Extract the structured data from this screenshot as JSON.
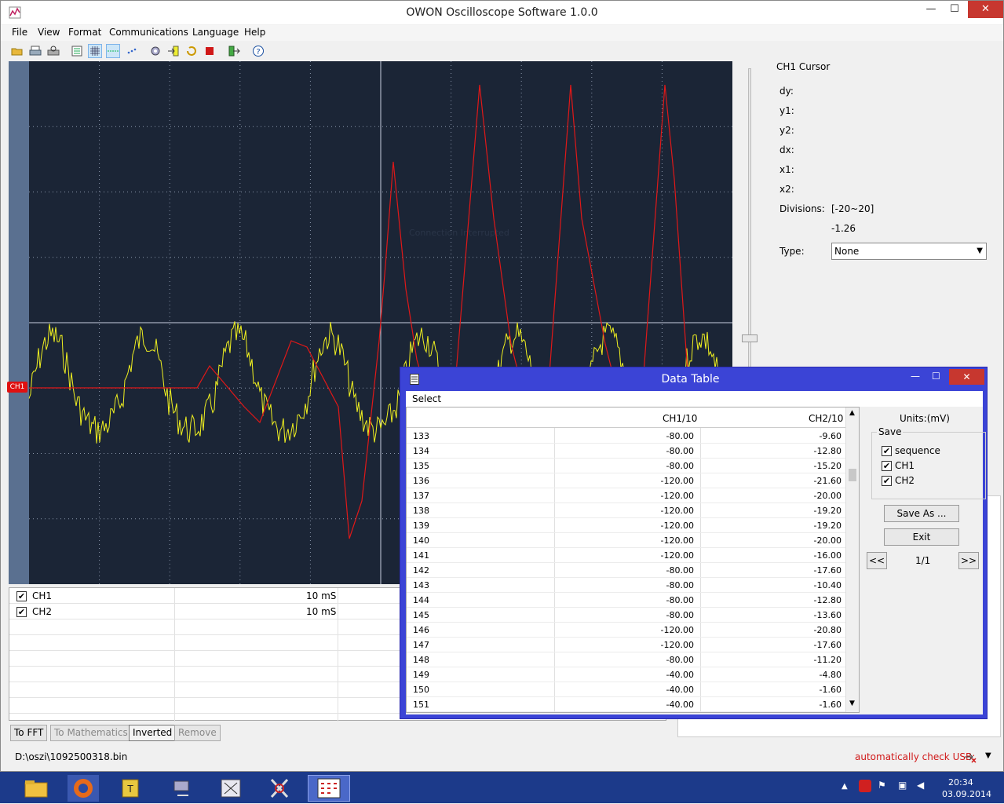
{
  "app": {
    "title": "OWON Oscilloscope Software 1.0.0"
  },
  "window_controls": {
    "minimize": "—",
    "maximize": "☐",
    "close": "✕"
  },
  "menu": [
    "File",
    "View",
    "Format",
    "Communications",
    "Language",
    "Help"
  ],
  "toolbar": [
    "open-icon",
    "print-icon",
    "print-preview-icon",
    "list-icon",
    "grid-icon",
    "cursor-line-icon",
    "dots-icon",
    "settings-icon",
    "import-icon",
    "refresh-icon",
    "stop-icon",
    "export-icon",
    "help-icon"
  ],
  "scope": {
    "channel_marker": "CH1",
    "ghost_text": "Connection Interrupted"
  },
  "cursor_panel": {
    "title": "CH1 Cursor",
    "dy": "dy:",
    "y1": "y1:",
    "y2": "y2:",
    "dx": "dx:",
    "x1": "x1:",
    "x2": "x2:",
    "divisions_label": "Divisions:",
    "divisions_value": "[-20~20]",
    "divisions_num": "-1.26",
    "type_label": "Type:",
    "type_value": "None"
  },
  "channels": [
    {
      "name": "CH1",
      "timebase": "10 mS",
      "checked": "✔"
    },
    {
      "name": "CH2",
      "timebase": "10 mS",
      "checked": "✔"
    }
  ],
  "actions": {
    "fft": "To FFT",
    "math": "To Mathematics",
    "inverted": "Inverted",
    "remove": "Remove"
  },
  "status": {
    "file": "D:\\oszi\\1092500318.bin",
    "usb": "automatically check USB:"
  },
  "data_table": {
    "title": "Data Table",
    "menu_select": "Select",
    "col_ch1": "CH1/10",
    "col_ch2": "CH2/10",
    "units": "Units:(mV)",
    "save_group": "Save",
    "opt_sequence": "sequence",
    "opt_ch1": "CH1",
    "opt_ch2": "CH2",
    "save_as": "Save As ...",
    "exit": "Exit",
    "prev": "<<",
    "next": ">>",
    "page": "1/1",
    "rows": [
      [
        "133",
        "-80.00",
        "-9.60"
      ],
      [
        "134",
        "-80.00",
        "-12.80"
      ],
      [
        "135",
        "-80.00",
        "-15.20"
      ],
      [
        "136",
        "-120.00",
        "-21.60"
      ],
      [
        "137",
        "-120.00",
        "-20.00"
      ],
      [
        "138",
        "-120.00",
        "-19.20"
      ],
      [
        "139",
        "-120.00",
        "-19.20"
      ],
      [
        "140",
        "-120.00",
        "-20.00"
      ],
      [
        "141",
        "-120.00",
        "-16.00"
      ],
      [
        "142",
        "-80.00",
        "-17.60"
      ],
      [
        "143",
        "-80.00",
        "-10.40"
      ],
      [
        "144",
        "-80.00",
        "-12.80"
      ],
      [
        "145",
        "-80.00",
        "-13.60"
      ],
      [
        "146",
        "-120.00",
        "-20.80"
      ],
      [
        "147",
        "-120.00",
        "-17.60"
      ],
      [
        "148",
        "-80.00",
        "-11.20"
      ],
      [
        "149",
        "-40.00",
        "-4.80"
      ],
      [
        "150",
        "-40.00",
        "-1.60"
      ],
      [
        "151",
        "-40.00",
        "-1.60"
      ]
    ]
  },
  "taskbar": {
    "time": "20:34",
    "date": "03.09.2014"
  },
  "colors": {
    "ch1_trace": "#e01818",
    "ch2_trace": "#f0f020",
    "scope_bg": "#1b2536",
    "table_frame": "#3b44d6"
  }
}
